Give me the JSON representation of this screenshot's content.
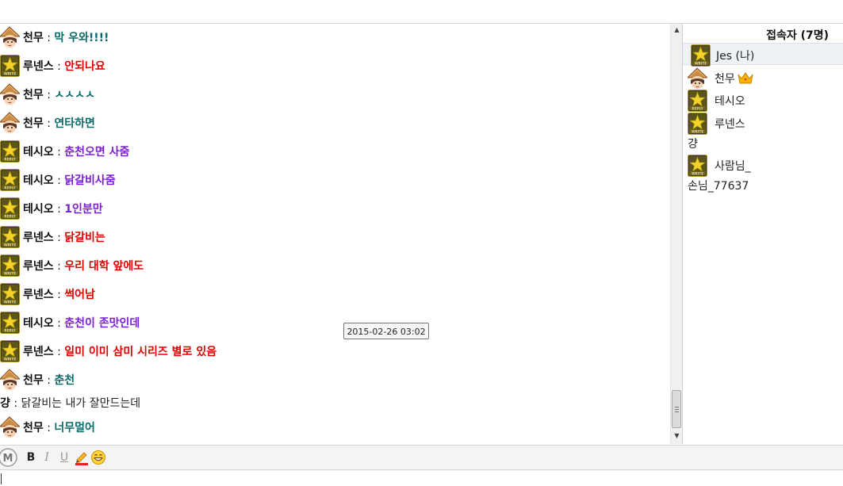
{
  "colors": {
    "cheonmu": "#0d6a6a",
    "runense": "#e00000",
    "tesio": "#7b1fd6",
    "plain": "#222222"
  },
  "messages": [
    {
      "nick": "천무",
      "sep": ":",
      "text": "막 우와!!!!",
      "color_key": "cheonmu",
      "avatar": "straw-hat-avatar"
    },
    {
      "nick": "루넨스",
      "sep": ":",
      "text": "안되나요",
      "color_key": "runense",
      "avatar": "write-badge-icon"
    },
    {
      "nick": "천무",
      "sep": ":",
      "text": "ㅅㅅㅅㅅ",
      "color_key": "cheonmu",
      "avatar": "straw-hat-avatar"
    },
    {
      "nick": "천무",
      "sep": ":",
      "text": "연타하면",
      "color_key": "cheonmu",
      "avatar": "straw-hat-avatar"
    },
    {
      "nick": "테시오",
      "sep": ":",
      "text": "춘천오면 사줌",
      "color_key": "tesio",
      "avatar": "reply-badge-icon"
    },
    {
      "nick": "테시오",
      "sep": ":",
      "text": "닭갈비사줌",
      "color_key": "tesio",
      "avatar": "reply-badge-icon"
    },
    {
      "nick": "테시오",
      "sep": ":",
      "text": "1인분만",
      "color_key": "tesio",
      "avatar": "reply-badge-icon"
    },
    {
      "nick": "루넨스",
      "sep": ":",
      "text": "닭갈비는",
      "color_key": "runense",
      "avatar": "write-badge-icon"
    },
    {
      "nick": "루넨스",
      "sep": ":",
      "text": "우리 대학 앞에도",
      "color_key": "runense",
      "avatar": "write-badge-icon"
    },
    {
      "nick": "루넨스",
      "sep": ":",
      "text": "썩어남",
      "color_key": "runense",
      "avatar": "write-badge-icon"
    },
    {
      "nick": "테시오",
      "sep": ":",
      "text": "춘천이 존맛인데",
      "color_key": "tesio",
      "avatar": "reply-badge-icon"
    },
    {
      "nick": "루넨스",
      "sep": ":",
      "text": "일미 이미 삼미 시리즈 별로 있음",
      "color_key": "runense",
      "avatar": "write-badge-icon"
    },
    {
      "nick": "천무",
      "sep": ":",
      "text": "춘천",
      "color_key": "cheonmu",
      "avatar": "straw-hat-avatar"
    },
    {
      "nick": "걍",
      "sep": ":",
      "text": "닭갈비는 내가 잘만드는데",
      "color_key": "plain",
      "avatar": ""
    },
    {
      "nick": "천무",
      "sep": ":",
      "text": "너무멀어",
      "color_key": "cheonmu",
      "avatar": "straw-hat-avatar"
    }
  ],
  "tooltip": "2015-02-26 03:02",
  "users_panel": {
    "header": "접속자 (7명)",
    "users": [
      {
        "name": "Jes (나)",
        "avatar": "write-badge-icon",
        "me": true
      },
      {
        "name": "천무",
        "avatar": "straw-hat-avatar",
        "badge": "crown-icon"
      },
      {
        "name": "테시오",
        "avatar": "reply-badge-icon"
      },
      {
        "name": "루넨스",
        "avatar": "write-badge-icon"
      },
      {
        "name": "걍",
        "avatar": ""
      },
      {
        "name": "사람님_",
        "avatar": "write-badge-icon"
      },
      {
        "name": "손님_77637",
        "avatar": ""
      }
    ]
  },
  "toolbar": {
    "bold": "B",
    "italic": "I",
    "underline": "U",
    "m_label": "M"
  }
}
